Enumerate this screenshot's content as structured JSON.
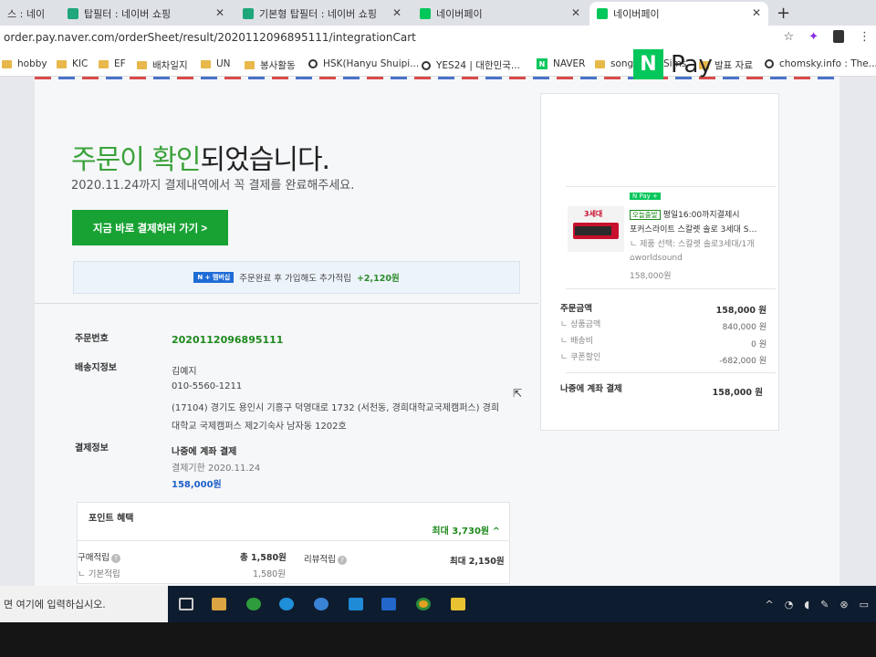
{
  "browser": {
    "tabs": [
      {
        "label": "스 : 네이"
      },
      {
        "label": "탑필터 : 네이버 쇼핑"
      },
      {
        "label": "기본형 탑필터 : 네이버 쇼핑"
      },
      {
        "label": "네이버페이"
      },
      {
        "label": "네이버페이"
      }
    ],
    "new_tab": "+",
    "url": "order.pay.naver.com/orderSheet/result/2020112096895111/integrationCart",
    "bookmarks": [
      "hobby",
      "KIC",
      "EF",
      "배차일지",
      "UN",
      "봉사활동",
      "HSK(Hanyu Shuipi...",
      "YES24 | 대한민국...",
      "NAVER",
      "songs",
      "Sims",
      "발표 자료",
      "chomsky.info : The..."
    ]
  },
  "page": {
    "headline_green": "주문이 확인",
    "headline_rest": "되었습니다.",
    "subtitle": "2020.11.24까지 결제내역에서 꼭 결제를 완료해주세요.",
    "pay_button": "지금 바로 결제하러 가기 >",
    "promo": {
      "badge_n": "N",
      "badge": "멤버십",
      "text": "주문완료 후 가입해도 추가적립",
      "amount": "+2,120원"
    },
    "order": {
      "order_no_label": "주문번호",
      "order_no": "2020112096895111",
      "shipping_label": "배송지정보",
      "name": "김예지",
      "phone": "010-5560-1211",
      "addr1": "(17104) 경기도 용인시 기흥구 덕영대로 1732 (서천동, 경희대학교국제캠퍼스) 경희",
      "addr2": "대학교 국제캠퍼스 제2기숙사 남자동 1202호",
      "payment_label": "결제정보",
      "payment_method": "나중에 계좌 결제",
      "deadline": "결제기한 2020.11.24",
      "amount": "158,000원"
    },
    "points": {
      "title": "포인트 혜택",
      "max": "최대 3,730원 ^",
      "purchase_label": "구매적립",
      "purchase_total": "총 1,580원",
      "basic_label": "ㄴ 기본적립",
      "basic_value": "1,580원",
      "review_label": "리뷰적립",
      "review_value": "최대 2,150원",
      "help": "?"
    }
  },
  "card": {
    "logo_n": "N",
    "logo_text": "Pay",
    "thumb_tag": "3세대",
    "badge_nplus": "N Pay +",
    "today_tag": "오늘출발",
    "ship_note": "평일16:00까지결제시",
    "product": "포커스라이트 스칼렛 솔로 3세대 S…",
    "option": "ㄴ 제품 선택: 스칼렛 솔로3세대/1개",
    "seller": "worldsound",
    "price": "158,000원",
    "summary": {
      "total_label": "주문금액",
      "total": "158,000 원",
      "product_label": "ㄴ 상품금액",
      "product_amt": "840,000 원",
      "ship_label": "ㄴ 배송비",
      "ship_amt": "0 원",
      "coupon_label": "ㄴ 쿠폰할인",
      "coupon_amt": "-682,000 원",
      "method_label": "나중에 계좌 결제",
      "method_amt": "158,000 원"
    }
  },
  "taskbar": {
    "search_placeholder": "면 여기에 입력하십시오."
  },
  "colors": {
    "naver_green": "#03c75a",
    "button_green": "#18a234",
    "link_blue": "#1f5fc8"
  }
}
